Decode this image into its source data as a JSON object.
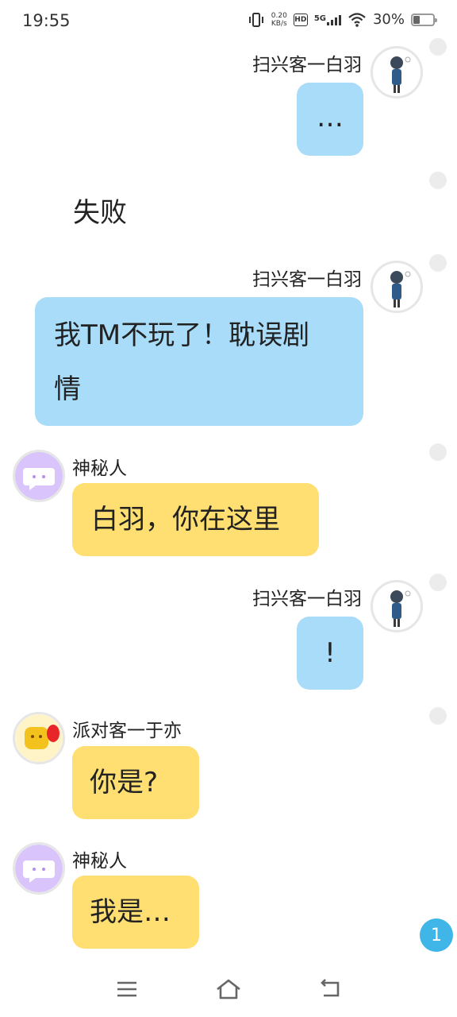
{
  "status_bar": {
    "time": "19:55",
    "net_speed_value": "0.20",
    "net_speed_unit": "KB/s",
    "hd": "HD",
    "network": "5G",
    "battery": "30%",
    "battery_level": 0.3
  },
  "messages": [
    {
      "speaker": "扫兴客一白羽",
      "text": "…",
      "side": "right"
    },
    {
      "narration": "失败"
    },
    {
      "speaker": "扫兴客一白羽",
      "text_line1": "我TM不玩了！耽误剧",
      "text_line2": "情",
      "side": "right"
    },
    {
      "speaker": "神秘人",
      "text": "白羽，你在这里",
      "side": "left"
    },
    {
      "speaker": "扫兴客一白羽",
      "text": "!",
      "side": "right"
    },
    {
      "speaker": "派对客一于亦",
      "text": "你是?",
      "side": "left"
    },
    {
      "speaker": "神秘人",
      "text": "我是…",
      "side": "left"
    }
  ],
  "unread_count": "1",
  "nav": {
    "menu_icon": "menu-icon",
    "home_icon": "home-icon",
    "back_icon": "back-icon"
  },
  "colors": {
    "self_bubble": "#a8dcf8",
    "other_bubble": "#ffdf72",
    "badge": "#3fb5e8"
  }
}
